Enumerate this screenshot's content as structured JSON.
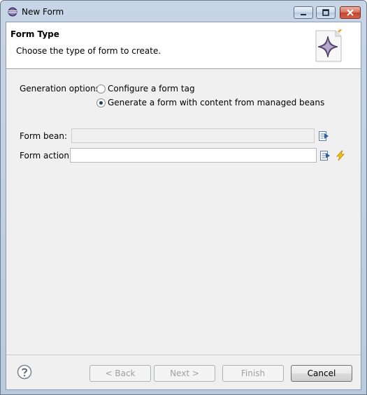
{
  "window": {
    "title": "New Form"
  },
  "header": {
    "title": "Form Type",
    "description": "Choose the type of form to create."
  },
  "generation": {
    "label": "Generation options:",
    "options": [
      {
        "label": "Configure a form tag",
        "checked": false
      },
      {
        "label": "Generate a form with content from managed beans",
        "checked": true
      }
    ]
  },
  "fields": {
    "form_bean": {
      "label": "Form bean:",
      "value": "",
      "enabled": false
    },
    "form_action": {
      "label": "Form action:",
      "value": "",
      "enabled": true
    }
  },
  "buttons": {
    "back": "< Back",
    "next": "Next >",
    "finish": "Finish",
    "cancel": "Cancel"
  },
  "colors": {
    "accent": "#1b3c66",
    "titlebar": "#c7d5e6"
  }
}
